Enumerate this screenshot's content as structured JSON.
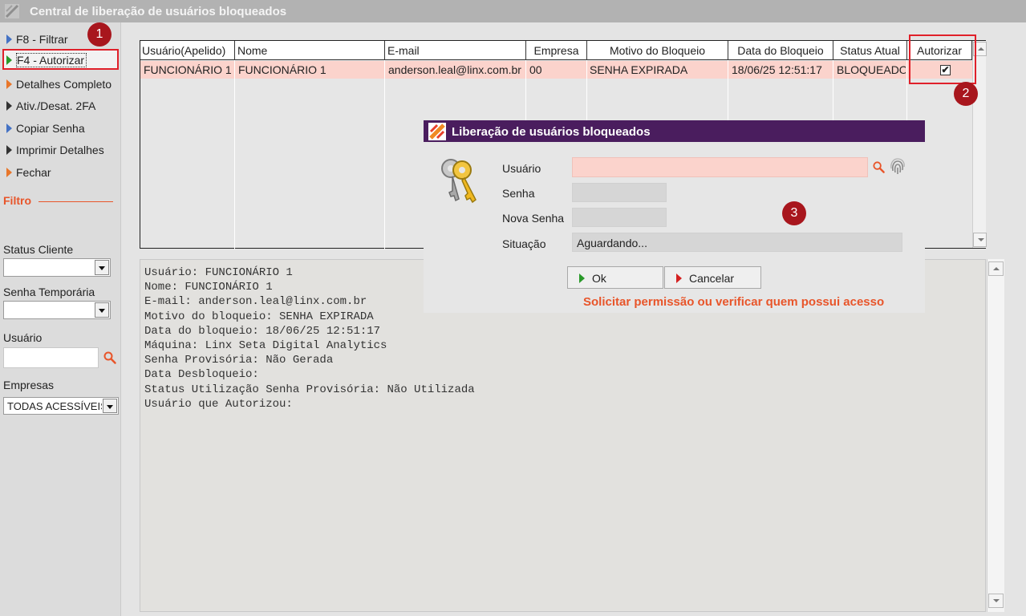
{
  "window": {
    "title": "Central de liberação de usuários bloqueados"
  },
  "sidebar": {
    "items": [
      {
        "label": "F8 - Filtrar",
        "color": "#4472c4"
      },
      {
        "label": "F4 - Autorizar",
        "color": "#2a9a2a"
      },
      {
        "label": "Detalhes Completo",
        "color": "#e8762a"
      },
      {
        "label": "Ativ./Desat. 2FA",
        "color": "#333333"
      },
      {
        "label": "Copiar Senha",
        "color": "#4472c4"
      },
      {
        "label": "Imprimir Detalhes",
        "color": "#333333"
      },
      {
        "label": "Fechar",
        "color": "#e8762a"
      }
    ],
    "filter_title": "Filtro",
    "status_cliente_label": "Status Cliente",
    "status_cliente_value": "",
    "senha_temporaria_label": "Senha Temporária",
    "senha_temporaria_value": "",
    "usuario_label": "Usuário",
    "usuario_value": "",
    "empresas_label": "Empresas",
    "empresas_value": "TODAS ACESSÍVEIS"
  },
  "grid": {
    "columns": [
      "Usuário(Apelido)",
      "Nome",
      "E-mail",
      "Empresa",
      "Motivo do Bloqueio",
      "Data do Bloqueio",
      "Status Atual",
      "Autorizar"
    ],
    "rows": [
      [
        "FUNCIONÁRIO 1",
        "FUNCIONÁRIO 1",
        "anderson.leal@linx.com.br",
        "00",
        "SENHA EXPIRADA",
        "18/06/25 12:51:17",
        "BLOQUEADO",
        "✔"
      ]
    ]
  },
  "details": [
    "Usuário: FUNCIONÁRIO 1",
    "Nome: FUNCIONÁRIO 1",
    "E-mail: anderson.leal@linx.com.br",
    "Motivo do bloqueio: SENHA EXPIRADA",
    "Data do bloqueio: 18/06/25 12:51:17",
    "Máquina: Linx Seta Digital Analytics",
    "Senha Provisória: Não Gerada",
    "Data Desbloqueio:",
    "Status Utilização Senha Provisória: Não Utilizada",
    "Usuário que Autorizou:"
  ],
  "dialog": {
    "title": "Liberação de usuários bloqueados",
    "usuario_label": "Usuário",
    "usuario_value": "",
    "senha_label": "Senha",
    "senha_value": "",
    "nova_senha_label": "Nova Senha",
    "nova_senha_value": "",
    "situacao_label": "Situação",
    "situacao_value": "Aguardando...",
    "ok_label": "Ok",
    "cancel_label": "Cancelar",
    "warning": "Solicitar permissão ou verificar quem possui acesso"
  },
  "annotations": {
    "badge1": "1",
    "badge2": "2",
    "badge3": "3"
  },
  "colors": {
    "accent_red": "#e0202a",
    "dialog_title_bg": "#4a1d5e",
    "row_highlight": "#fbd3cc",
    "warning_text": "#e8552a"
  }
}
